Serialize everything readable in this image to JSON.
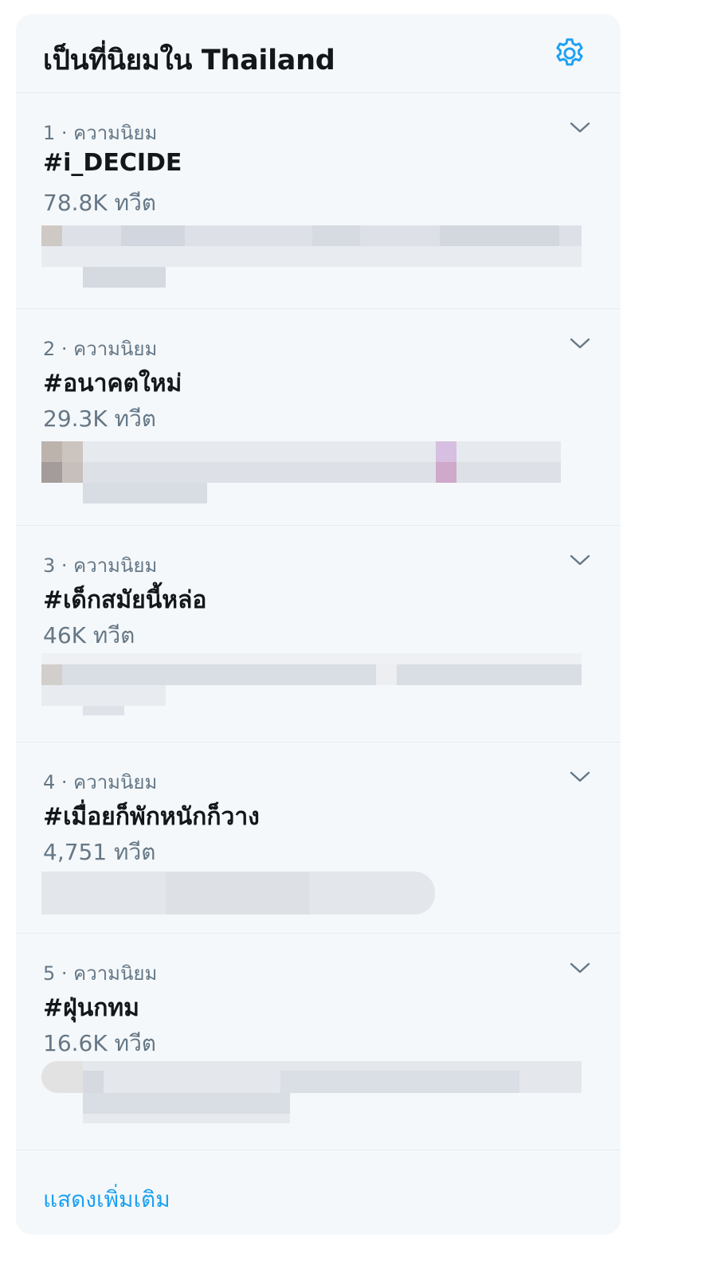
{
  "widget": {
    "title": "เป็นที่นิยมใน Thailand",
    "accent_color": "#1da1f2",
    "settings_icon": "gear-icon",
    "expand_icon": "chevron-down-icon"
  },
  "trends": [
    {
      "meta": "1 · ความนิยม",
      "name": "#i_DECIDE",
      "count": "78.8K ทวีต"
    },
    {
      "meta": "2 · ความนิยม",
      "name": "#อนาคตใหม่",
      "count": "29.3K ทวีต"
    },
    {
      "meta": "3 · ความนิยม",
      "name": "#เด็กสมัยนี้หล่อ",
      "count": "46K ทวีต"
    },
    {
      "meta": "4 · ความนิยม",
      "name": "#เมื่อยก็พักหนักก็วาง",
      "count": "4,751 ทวีต"
    },
    {
      "meta": "5 · ความนิยม",
      "name": "#ฝุ่นกทม",
      "count": "16.6K ทวีต"
    }
  ],
  "footer": {
    "show_more_label": "แสดงเพิ่มเติม"
  }
}
